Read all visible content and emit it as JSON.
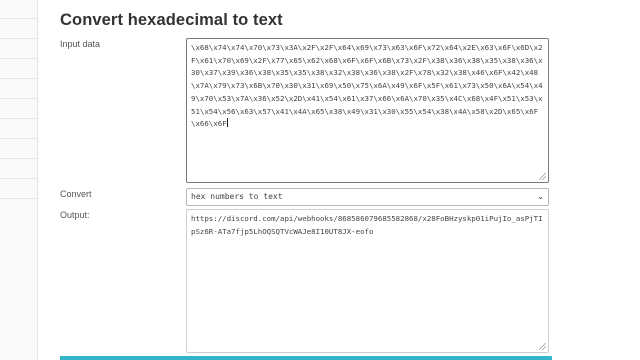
{
  "page": {
    "title": "Convert hexadecimal to text"
  },
  "input": {
    "label": "Input data",
    "value": "\\x68\\x74\\x74\\x70\\x73\\x3A\\x2F\\x2F\\x64\\x69\\x73\\x63\\x6F\\x72\\x64\\x2E\\x63\\x6F\\x6D\\x2F\\x61\\x70\\x69\\x2F\\x77\\x65\\x62\\x68\\x6F\\x6F\\x6B\\x73\\x2F\\x38\\x36\\x38\\x35\\x38\\x36\\x30\\x37\\x39\\x36\\x38\\x35\\x35\\x38\\x32\\x38\\x36\\x38\\x2F\\x78\\x32\\x38\\x46\\x6F\\x42\\x48\\x7A\\x79\\x73\\x6B\\x70\\x30\\x31\\x69\\x50\\x75\\x6A\\x49\\x6F\\x5F\\x61\\x73\\x50\\x6A\\x54\\x49\\x70\\x53\\x7A\\x36\\x52\\x2D\\x41\\x54\\x61\\x37\\x66\\x6A\\x70\\x35\\x4C\\x68\\x4F\\x51\\x53\\x51\\x54\\x56\\x63\\x57\\x41\\x4A\\x65\\x38\\x49\\x31\\x30\\x55\\x54\\x38\\x4A\\x58\\x2D\\x65\\x6F\\x66\\x6F"
  },
  "convert": {
    "label": "Convert",
    "selected": "hex numbers to text"
  },
  "output": {
    "label": "Output:",
    "value": "https://discord.com/api/webhooks/868586079685582868/x28FoBHzyskp01iPujIo_asPjTIpSz6R-ATa7fjp5LhOQSQTVcWAJe8I10UT8JX-eofo"
  },
  "colors": {
    "accent": "#35b6c8"
  }
}
